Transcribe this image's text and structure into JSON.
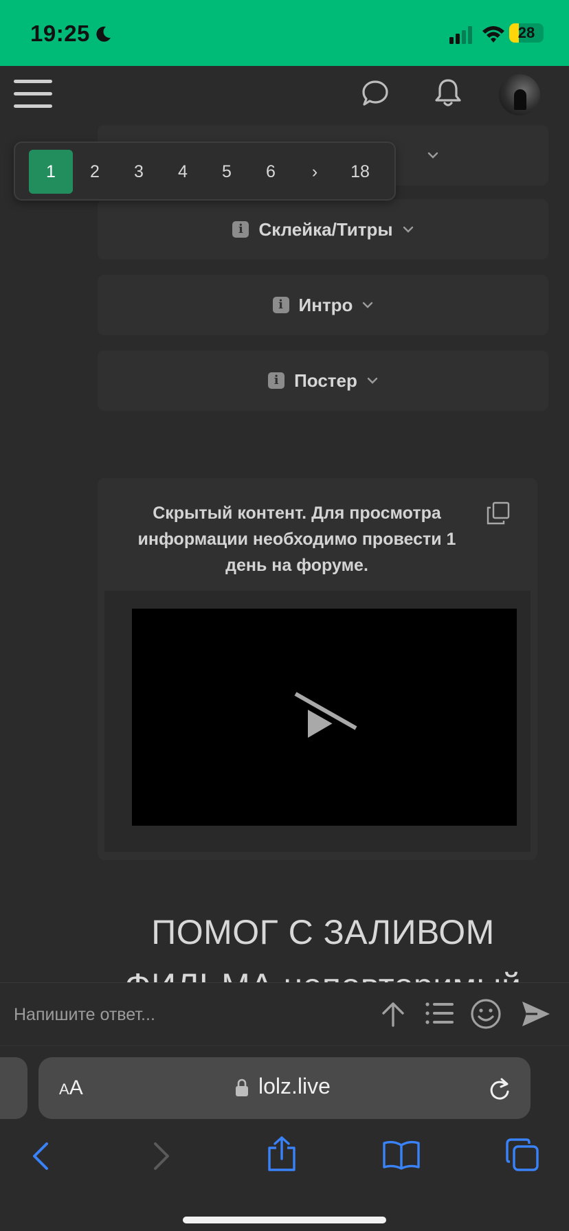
{
  "status_bar": {
    "time": "19:25",
    "battery": "28",
    "battery_level": 0.28,
    "icons": [
      "moon-icon",
      "signal-icon",
      "wifi-icon",
      "battery-icon"
    ],
    "background": "#00ba78"
  },
  "header": {
    "icons": [
      "menu-icon",
      "chat-icon",
      "bell-icon",
      "avatar"
    ]
  },
  "pagination": {
    "pages": [
      "1",
      "2",
      "3",
      "4",
      "5",
      "6",
      "›",
      "18"
    ],
    "active": "1",
    "active_color": "#228e5d"
  },
  "spoilers": [
    {
      "title": "Склейка/Титры"
    },
    {
      "title": "Интро"
    },
    {
      "title": "Постер"
    }
  ],
  "hidden_content": {
    "text": "Скрытый контент. Для просмотра информации необходимо провести 1 день на форуме."
  },
  "post": {
    "heading": "ПОМОГ С ЗАЛИВОМ ФИЛЬМА неповторимый"
  },
  "reply": {
    "placeholder": "Напишите ответ..."
  },
  "browser": {
    "aa_small": "A",
    "aa_large": "A",
    "url": "lolz.live",
    "accent": "#3a82f7"
  }
}
